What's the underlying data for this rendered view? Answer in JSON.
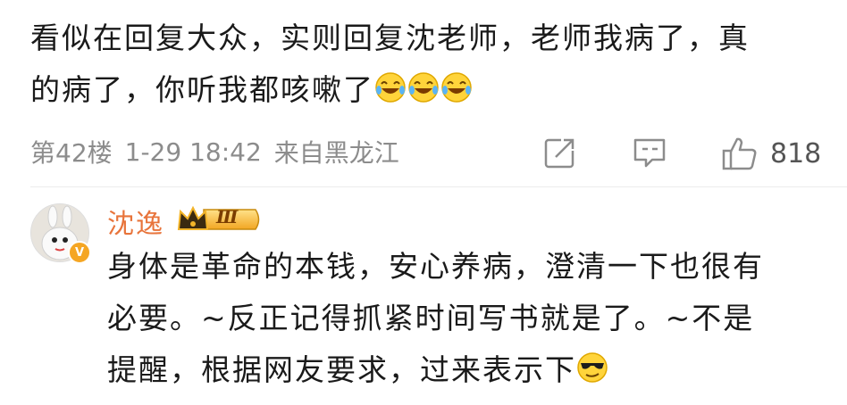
{
  "previous_comment": {
    "text_lines": [
      "看似在回复大众，实则回复沈老师，老师我病了，真",
      "的病了，你听我都咳嗽了"
    ],
    "emojis": [
      "laugh-cry-emoji",
      "laugh-cry-emoji",
      "laugh-cry-emoji"
    ],
    "floor": "第42楼",
    "date": "1-29 18:42",
    "location": "来自黑龙江",
    "like_count": "818"
  },
  "reply": {
    "username": "沈逸",
    "level_badge": "Ⅲ",
    "text_lines": [
      "身体是革命的本钱，安心养病，澄清一下也很有",
      "必要。~反正记得抓紧时间写书就是了。~不是",
      "提醒，根据网友要求，过来表示下"
    ],
    "emoji": "cool-sunglasses-emoji"
  },
  "colors": {
    "username": "#e8743b",
    "meta_gray": "#8c8c8c",
    "badge_gold": "#f5b82e"
  }
}
